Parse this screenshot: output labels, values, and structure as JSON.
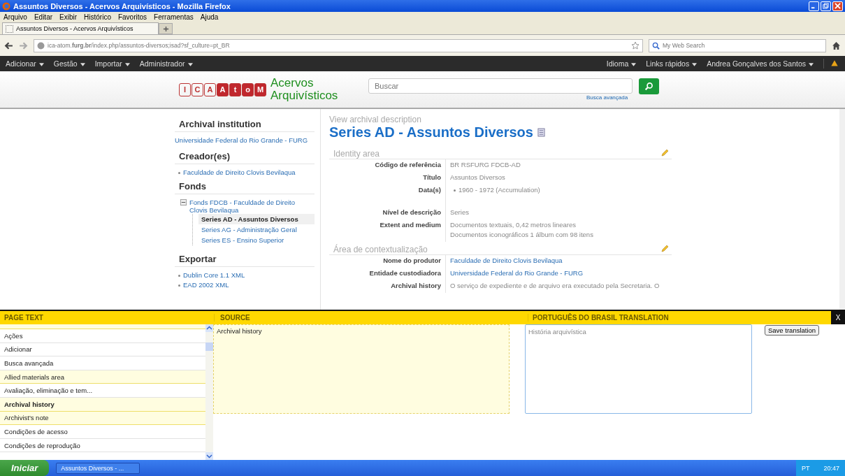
{
  "window": {
    "title": "Assuntos Diversos - Acervos Arquivísticos - Mozilla Firefox"
  },
  "menu": [
    "Arquivo",
    "Editar",
    "Exibir",
    "Histórico",
    "Favoritos",
    "Ferramentas",
    "Ajuda"
  ],
  "tabs": [
    {
      "label": "Assuntos Diversos - Acervos Arquivísticos",
      "selected": true
    }
  ],
  "address": {
    "value": "ica-atom.**furg.br**/index.php/assuntos-diversos;isad?sf_culture=pt_BR"
  },
  "web_search": {
    "placeholder": "My Web Search"
  },
  "admin_bar": {
    "left": [
      "Adicionar",
      "Gestão",
      "Importar",
      "Administrador"
    ],
    "right": [
      "Idioma",
      "Links rápidos",
      "Andrea Gonçalves dos Santos"
    ]
  },
  "header": {
    "logo": [
      {
        "letter": "I",
        "filled": false
      },
      {
        "letter": "C",
        "filled": false
      },
      {
        "letter": "A",
        "filled": false
      },
      {
        "letter": "A",
        "filled": true
      },
      {
        "letter": "t",
        "filled": true
      },
      {
        "letter": "o",
        "filled": true
      },
      {
        "letter": "M",
        "filled": true
      }
    ],
    "site_name": "Acervos Arquivísticos",
    "search": {
      "placeholder": "Buscar"
    },
    "advanced_search": "Busca avançada"
  },
  "sidebar": [
    {
      "heading": "Archival institution",
      "kind": "plain",
      "items": [
        {
          "label": "Universidade Federal do Rio Grande - FURG"
        }
      ]
    },
    {
      "heading": "Creador(es)",
      "kind": "bullets",
      "items": [
        {
          "label": "Faculdade de Direito Clovis Bevilaqua"
        }
      ]
    },
    {
      "heading": "Fonds",
      "kind": "tree",
      "items": [
        {
          "label": "Fonds FDCB - Faculdade de Direito Clovis Bevilaqua",
          "expanded": true,
          "children": [
            {
              "label": "Series AD - Assuntos Diversos",
              "selected": true
            },
            {
              "label": "Series AG - Administração Geral",
              "selected": false
            },
            {
              "label": "Series ES - Ensino Superior",
              "selected": false
            }
          ]
        }
      ]
    },
    {
      "heading": "Exportar",
      "kind": "bullets",
      "items": [
        {
          "label": "Dublin Core 1.1 XML"
        },
        {
          "label": "EAD 2002 XML"
        }
      ]
    }
  ],
  "main": {
    "breadcrumb": "View archival description",
    "title": "Series AD - Assuntos Diversos",
    "areas": [
      {
        "heading": "Identity area",
        "fields": [
          {
            "label": "Código de referência",
            "kind": "text",
            "values": [
              "BR RSFURG FDCB-AD"
            ]
          },
          {
            "label": "Título",
            "kind": "text",
            "values": [
              "Assuntos Diversos"
            ]
          },
          {
            "label": "Data(s)",
            "kind": "bullet",
            "values": [
              "1960 - 1972 (Accumulation)"
            ]
          },
          {
            "label": "Nível de descrição",
            "kind": "text",
            "values": [
              "Series"
            ]
          },
          {
            "label": "Extent and medium",
            "kind": "text",
            "values": [
              "Documentos textuais, 0,42 metros lineares",
              "Documentos iconográficos 1 álbum com 98 itens"
            ]
          }
        ]
      },
      {
        "heading": "Área de contextualização",
        "fields": [
          {
            "label": "Nome do produtor",
            "kind": "link",
            "values": [
              "Faculdade de Direito Clovis Bevilaqua"
            ]
          },
          {
            "label": "Entidade custodiadora",
            "kind": "link",
            "values": [
              "Universidade Federal do Rio Grande - FURG"
            ]
          },
          {
            "label": "Archival history",
            "kind": "text",
            "values": [
              "O serviço de expediente e de arquivo era executado pela Secretaria. O"
            ]
          }
        ]
      }
    ]
  },
  "translate_panel": {
    "headers": [
      "PAGE TEXT",
      "SOURCE",
      "PORTUGUÊS DO BRASIL TRANSLATION"
    ],
    "close": "X",
    "page_text": [
      {
        "label": "Ações",
        "highlighted": false,
        "selected": false
      },
      {
        "label": "Adicionar",
        "highlighted": false,
        "selected": false
      },
      {
        "label": "Busca avançada",
        "highlighted": false,
        "selected": false
      },
      {
        "label": "Allied materials area",
        "highlighted": true,
        "selected": false
      },
      {
        "label": "Avaliação, eliminação e tem...",
        "highlighted": false,
        "selected": false
      },
      {
        "label": "Archival history",
        "highlighted": true,
        "selected": true
      },
      {
        "label": "Archivist's note",
        "highlighted": true,
        "selected": false
      },
      {
        "label": "Condições de acesso",
        "highlighted": false,
        "selected": false
      },
      {
        "label": "Condições de reprodução",
        "highlighted": false,
        "selected": false
      }
    ],
    "source": "Archival history",
    "translation": {
      "value": "História arquivística"
    },
    "save_button": "Save translation"
  },
  "taskbar": {
    "start": "Iniciar",
    "tasks": [
      {
        "label": "Assuntos Diversos - ...",
        "selected": false
      }
    ],
    "language": "PT",
    "clock": "20:47"
  }
}
